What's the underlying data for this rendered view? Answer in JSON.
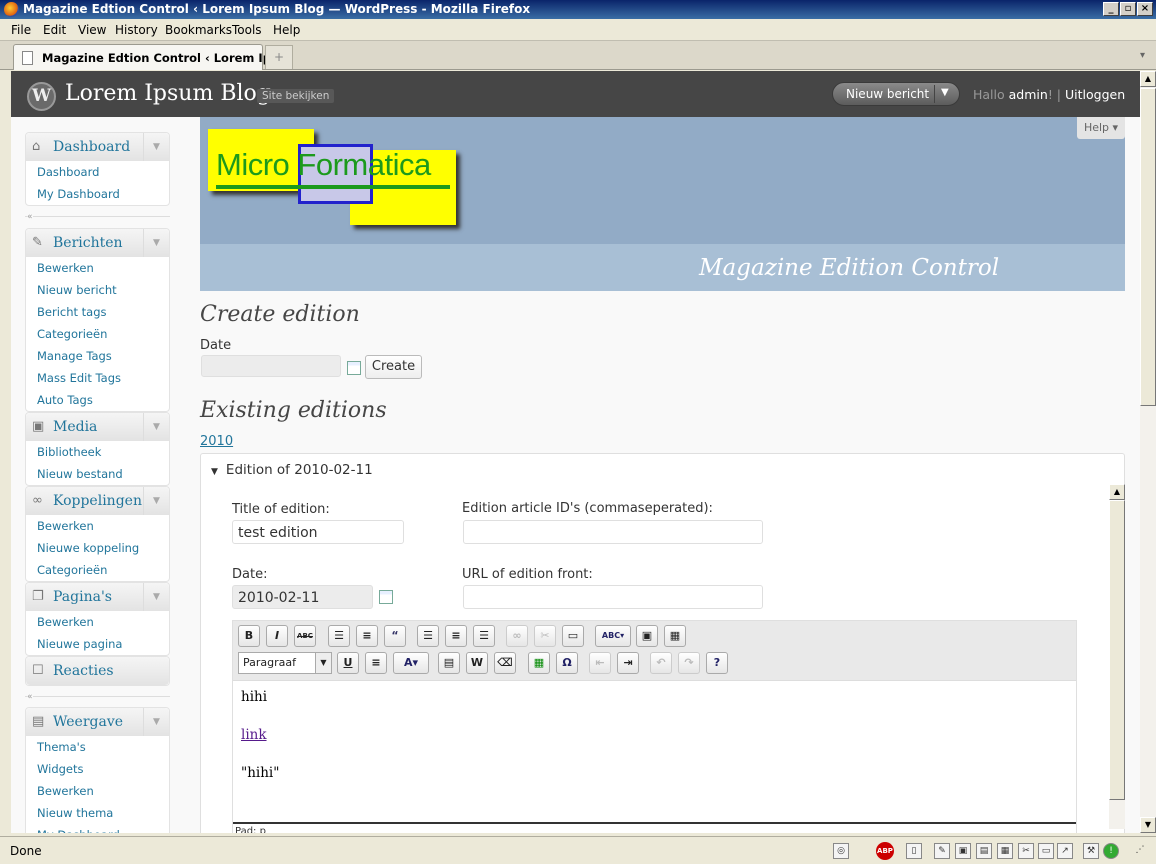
{
  "window": {
    "title": "Magazine Edtion Control ‹ Lorem Ipsum Blog — WordPress - Mozilla Firefox"
  },
  "menu": [
    "File",
    "Edit",
    "View",
    "History",
    "Bookmarks",
    "Tools",
    "Help"
  ],
  "tab": {
    "label": "Magazine Edtion Control ‹ Lorem Ips...",
    "newtab": "+"
  },
  "wp_header": {
    "blog_name": "Lorem Ipsum Blog",
    "visit_site": "Site bekijken",
    "new_post": "Nieuw bericht",
    "greeting": "Hallo",
    "user": "admin",
    "greeting_end": "! |",
    "logout": "Uitloggen"
  },
  "sidebar": {
    "dashboard": {
      "title": "Dashboard",
      "items": [
        "Dashboard",
        "My Dashboard"
      ]
    },
    "berichten": {
      "title": "Berichten",
      "items": [
        "Bewerken",
        "Nieuw bericht",
        "Bericht tags",
        "Categorieën",
        "Manage Tags",
        "Mass Edit Tags",
        "Auto Tags"
      ]
    },
    "media": {
      "title": "Media",
      "items": [
        "Bibliotheek",
        "Nieuw bestand"
      ]
    },
    "koppelingen": {
      "title": "Koppelingen",
      "items": [
        "Bewerken",
        "Nieuwe koppeling",
        "Categorieën"
      ]
    },
    "paginas": {
      "title": "Pagina's",
      "items": [
        "Bewerken",
        "Nieuwe pagina"
      ]
    },
    "reacties": {
      "title": "Reacties"
    },
    "weergave": {
      "title": "Weergave",
      "items": [
        "Thema's",
        "Widgets",
        "Bewerken",
        "Nieuw thema",
        "My Dashboard"
      ]
    }
  },
  "banner": {
    "logo_text_1": "Micro",
    "logo_text_2": "Formatica",
    "title": "Magazine Edition Control",
    "help": "Help"
  },
  "create": {
    "heading": "Create edition",
    "date_label": "Date",
    "date_value": "",
    "create_button": "Create"
  },
  "existing": {
    "heading": "Existing editions",
    "year": "2010",
    "edition": {
      "header": "Edition of 2010-02-11",
      "title_label": "Title of edition:",
      "title_value": "test edition",
      "ids_label": "Edition article ID's (commaseperated):",
      "ids_value": "",
      "date_label": "Date:",
      "date_value": "2010-02-11",
      "url_label": "URL of edition front:",
      "url_value": ""
    }
  },
  "editor": {
    "format_select": "Paragraaf",
    "content": [
      "hihi",
      "link",
      "\"hihi\""
    ],
    "path": "Pad: p"
  },
  "status": {
    "text": "Done"
  }
}
